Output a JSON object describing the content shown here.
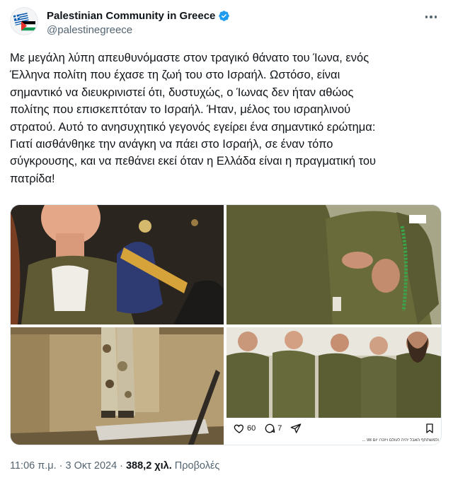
{
  "account": {
    "display_name": "Palestinian Community in Greece",
    "handle": "@palestinegreece",
    "verified": true,
    "avatar_icon": "greek-palestinian-flags-icon"
  },
  "tweet": {
    "text": "Με μεγάλη λύπη απευθυνόμαστε στον τραγικό θάνατο του Ίωνα, ενός\nΈλληνα πολίτη που έχασε τη ζωή του στο Ισραήλ. Ωστόσο, είναι\nσημαντικό να διευκρινιστεί ότι, δυστυχώς, ο Ίωνας δεν ήταν αθώος\nπολίτης που επισκεπτόταν το Ισραήλ. Ήταν, μέλος του ισραηλινού\nστρατού. Αυτό το ανησυχητικό γεγονός εγείρει ένα σημαντικό ερώτημα:\nΓιατί αισθάνθηκε την ανάγκη να πάει στο Ισραήλ, σε έναν τόπο\nσύγκρουσης, και να πεθάνει εκεί όταν η Ελλάδα είναι η πραγματική του\nπατρίδα!"
  },
  "media": {
    "instagram": {
      "likes": "60",
      "comments": "7",
      "caption": "ולמשתתף האבל יהיה לעולם ויזכרו יום 98 ..."
    }
  },
  "footer": {
    "time": "11:06 π.μ.",
    "separator": "·",
    "date": "3 Οκτ 2024",
    "views_count": "388,2 χιλ.",
    "views_label": "Προβολές"
  },
  "colors": {
    "verified_badge": "#1d9bf0",
    "secondary_text": "#536471",
    "primary_text": "#0f1419"
  }
}
